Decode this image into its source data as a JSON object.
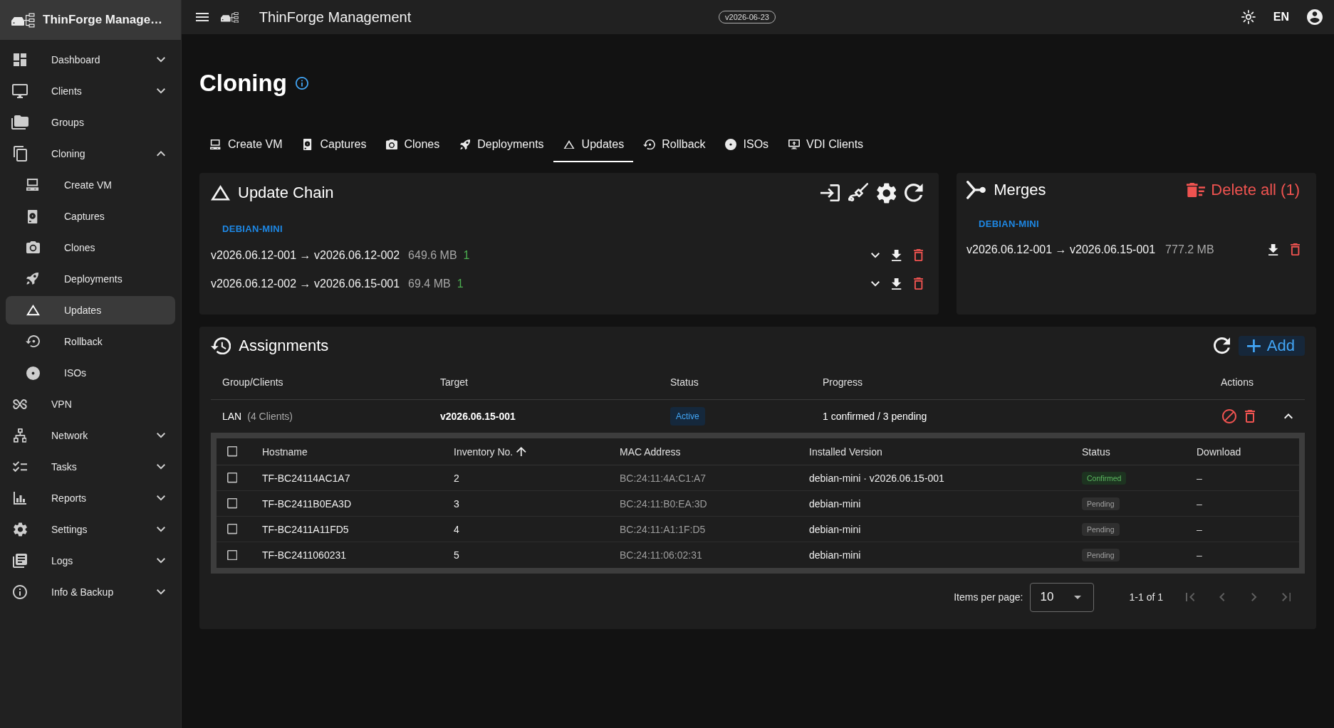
{
  "sidebar": {
    "app_title": "ThinForge Manage…",
    "items": [
      {
        "label": "Dashboard",
        "kind": "group",
        "expanded": false,
        "selected": false
      },
      {
        "label": "Clients",
        "kind": "group",
        "expanded": false,
        "selected": false
      },
      {
        "label": "Groups",
        "kind": "link",
        "selected": false
      },
      {
        "label": "Cloning",
        "kind": "group",
        "expanded": true,
        "selected": false,
        "children": [
          {
            "label": "Create VM",
            "selected": false
          },
          {
            "label": "Captures",
            "selected": false
          },
          {
            "label": "Clones",
            "selected": false
          },
          {
            "label": "Deployments",
            "selected": false
          },
          {
            "label": "Updates",
            "selected": true
          },
          {
            "label": "Rollback",
            "selected": false
          },
          {
            "label": "ISOs",
            "selected": false
          }
        ]
      },
      {
        "label": "VPN",
        "kind": "link",
        "selected": false
      },
      {
        "label": "Network",
        "kind": "group",
        "expanded": false,
        "selected": false
      },
      {
        "label": "Tasks",
        "kind": "group",
        "expanded": false,
        "selected": false
      },
      {
        "label": "Reports",
        "kind": "group",
        "expanded": false,
        "selected": false
      },
      {
        "label": "Settings",
        "kind": "group",
        "expanded": false,
        "selected": false
      },
      {
        "label": "Logs",
        "kind": "group",
        "expanded": false,
        "selected": false
      },
      {
        "label": "Info & Backup",
        "kind": "group",
        "expanded": false,
        "selected": false
      }
    ]
  },
  "top_bar": {
    "title": "ThinForge Management",
    "version": "v2026-06-23",
    "language": "EN"
  },
  "page": {
    "title": "Cloning"
  },
  "tabs": [
    {
      "label": "Create VM",
      "selected": false
    },
    {
      "label": "Captures",
      "selected": false
    },
    {
      "label": "Clones",
      "selected": false
    },
    {
      "label": "Deployments",
      "selected": false
    },
    {
      "label": "Updates",
      "selected": true
    },
    {
      "label": "Rollback",
      "selected": false
    },
    {
      "label": "ISOs",
      "selected": false
    },
    {
      "label": "VDI Clients",
      "selected": false
    }
  ],
  "update_chain": {
    "title": "Update Chain",
    "groups": [
      {
        "name": "DEBIAN-MINI",
        "updates": [
          {
            "transition": "v2026.06.12-001 → v2026.06.12-002",
            "size": "649.6 MB",
            "count": "1",
            "expanded": false
          },
          {
            "transition": "v2026.06.12-002 → v2026.06.15-001",
            "size": "69.4 MB",
            "count": "1",
            "expanded": false
          }
        ]
      }
    ]
  },
  "merges": {
    "title": "Merges",
    "delete_all_label": "Delete all (1)",
    "groups": [
      {
        "name": "DEBIAN-MINI",
        "merges": [
          {
            "transition": "v2026.06.12-001 → v2026.06.15-001",
            "size": "777.2 MB"
          }
        ]
      }
    ]
  },
  "assignments": {
    "title": "Assignments",
    "add_label": "Add",
    "columns": [
      "Group/Clients",
      "Target",
      "Status",
      "Progress",
      "Actions"
    ],
    "rows": [
      {
        "group": "LAN",
        "clients": "(4 Clients)",
        "target": "v2026.06.15-001",
        "status": {
          "label": "Active",
          "kind": "active"
        },
        "progress": "1 confirmed / 3 pending",
        "expanded": true,
        "clients_table": {
          "select_all_checked": false,
          "columns": [
            {
              "label": "Hostname"
            },
            {
              "label": "Inventory No.",
              "sort_ascending": true
            },
            {
              "label": "MAC Address"
            },
            {
              "label": "Installed Version"
            },
            {
              "label": "Status"
            },
            {
              "label": "Download"
            }
          ],
          "rows": [
            {
              "checked": false,
              "hostname": "TF-BC24114AC1A7",
              "inventory_no": "2",
              "mac_address": "BC:24:11:4A:C1:A7",
              "installed_version": "debian-mini · v2026.06.15-001",
              "status": {
                "label": "Confirmed",
                "kind": "confirmed"
              },
              "download": "–"
            },
            {
              "checked": false,
              "hostname": "TF-BC2411B0EA3D",
              "inventory_no": "3",
              "mac_address": "BC:24:11:B0:EA:3D",
              "installed_version": "debian-mini",
              "status": {
                "label": "Pending",
                "kind": "pending"
              },
              "download": "–"
            },
            {
              "checked": false,
              "hostname": "TF-BC2411A11FD5",
              "inventory_no": "4",
              "mac_address": "BC:24:11:A1:1F:D5",
              "installed_version": "debian-mini",
              "status": {
                "label": "Pending",
                "kind": "pending"
              },
              "download": "–"
            },
            {
              "checked": false,
              "hostname": "TF-BC2411060231",
              "inventory_no": "5",
              "mac_address": "BC:24:11:06:02:31",
              "installed_version": "debian-mini",
              "status": {
                "label": "Pending",
                "kind": "pending"
              },
              "download": "–"
            }
          ]
        }
      }
    ]
  },
  "pagination": {
    "items_per_page_label": "Items per page:",
    "items_per_page": "10",
    "range": "1-1 of 1",
    "nav": [
      {
        "kind": "first",
        "disabled": true
      },
      {
        "kind": "previous",
        "disabled": true
      },
      {
        "kind": "next",
        "disabled": true
      },
      {
        "kind": "last",
        "disabled": true
      }
    ]
  }
}
